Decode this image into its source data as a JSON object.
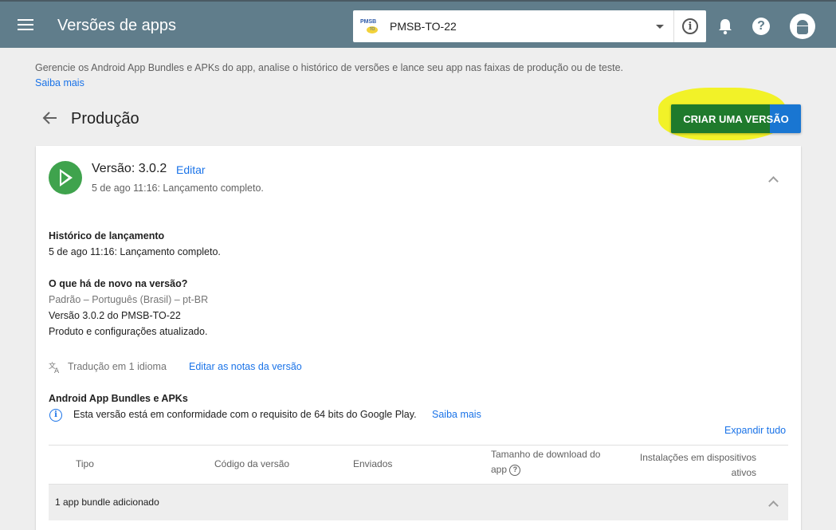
{
  "topbar": {
    "title": "Versões de apps",
    "app_selector": {
      "value": "PMSB-TO-22",
      "logo_text_top": "PMSB",
      "logo_text_bottom": "TO"
    }
  },
  "intro": {
    "description": "Gerencie os Android App Bundles e APKs do app, analise o histórico de versões e lance seu app nas faixas de produção ou de teste.",
    "learn_more": "Saiba mais"
  },
  "header": {
    "title": "Produção",
    "create_button": "CRIAR UMA VERSÃO"
  },
  "release": {
    "title": "Versão: 3.0.2",
    "edit_label": "Editar",
    "subtitle": "5 de ago 11:16: Lançamento completo.",
    "history_heading": "Histórico de lançamento",
    "history_text": "5 de ago 11:16: Lançamento completo.",
    "whats_new_heading": "O que há de novo na versão?",
    "language": "Padrão – Português (Brasil) – pt-BR",
    "notes_line1": "Versão 3.0.2 do PMSB-TO-22",
    "notes_line2": "Produto e configurações atualizado.",
    "translation_text": "Tradução em 1 idioma",
    "edit_notes_link": "Editar as notas da versão",
    "bundles_heading": "Android App Bundles e APKs",
    "compliance_text": "Esta versão está em conformidade com o requisito de 64 bits do Google Play.",
    "compliance_link": "Saiba mais",
    "expand_all": "Expandir tudo",
    "table": {
      "columns": [
        "Tipo",
        "Código da versão",
        "Enviados",
        "Tamanho de download do app",
        "Instalações em dispositivos ativos"
      ],
      "col4_line1": "Tamanho de download do",
      "col4_line2": "app",
      "col5_line1": "Instalações em dispositivos",
      "col5_line2": "ativos",
      "group_row": "1 app bundle adicionado"
    }
  },
  "colors": {
    "topbar": "#607d8b",
    "accent_button": "#1976d2",
    "link": "#1a73e8",
    "release_icon": "#3fa34d",
    "highlight": "#f2f212"
  }
}
